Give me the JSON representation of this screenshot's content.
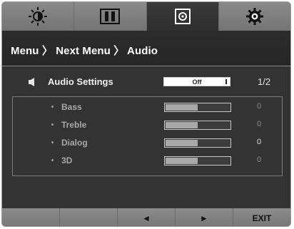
{
  "breadcrumb": "Menu 〉 Next Menu 〉 Audio",
  "tabs": [
    {
      "icon": "brightness-icon"
    },
    {
      "icon": "picture-icon"
    },
    {
      "icon": "audio-icon",
      "active": true
    },
    {
      "icon": "settings-gear-icon"
    }
  ],
  "audio_settings": {
    "label": "Audio Settings",
    "value": "Off",
    "page": "1/2"
  },
  "sub_settings": [
    {
      "label": "Bass",
      "value": "0",
      "level": 0.5
    },
    {
      "label": "Treble",
      "value": "0",
      "level": 0.5
    },
    {
      "label": "Dialog",
      "value": "0",
      "level": 0.5
    },
    {
      "label": "3D",
      "value": "0",
      "level": 0.5
    }
  ],
  "bottom": {
    "left_arrow": "◄",
    "right_arrow": "►",
    "exit": "EXIT"
  },
  "colors": {
    "panel": "#333333",
    "tab_bar": "#7e7e7e",
    "active_tab": "#2e2e2e",
    "text": "#ffffff"
  }
}
